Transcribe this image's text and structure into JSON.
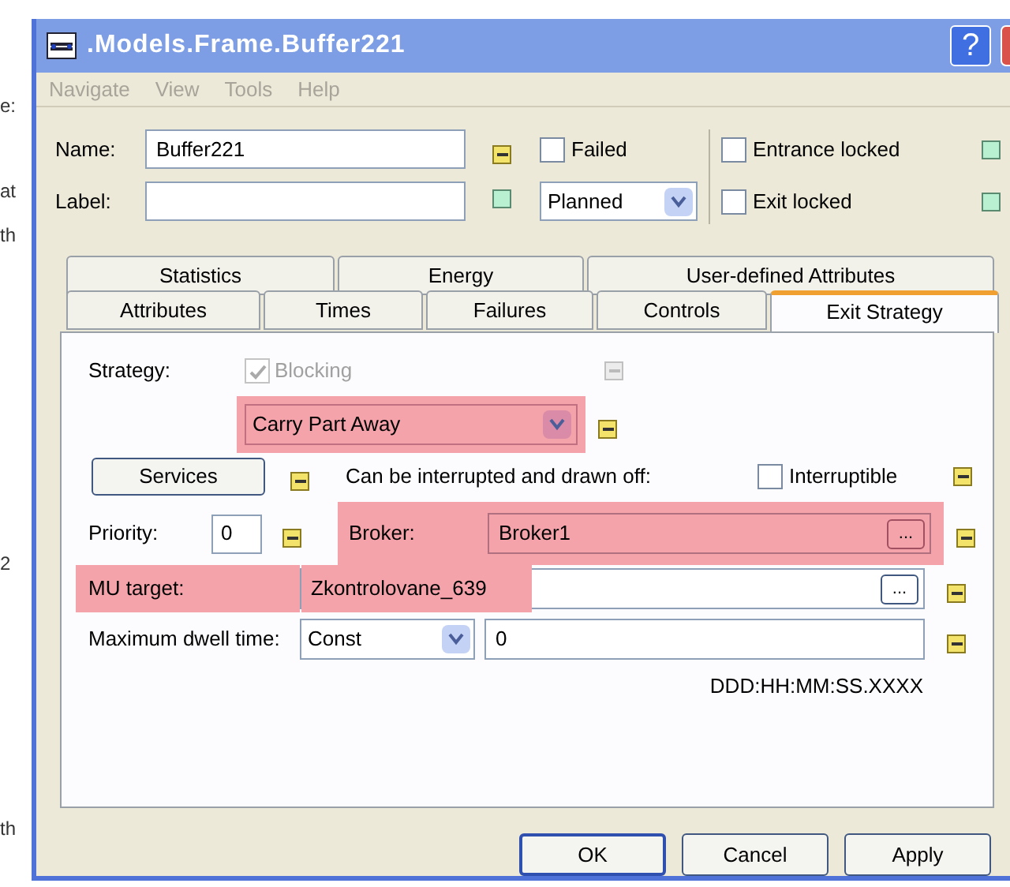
{
  "background_fragments": [
    "e:",
    "at",
    "th",
    "2",
    "th"
  ],
  "window": {
    "title": ".Models.Frame.Buffer221",
    "help": "?"
  },
  "menu": [
    {
      "label": "Navigate",
      "disabled": true
    },
    {
      "label": "View",
      "disabled": true
    },
    {
      "label": "Tools",
      "disabled": true
    },
    {
      "label": "Help",
      "disabled": true
    }
  ],
  "header": {
    "name": {
      "label": "Name:",
      "value": "Buffer221",
      "inherited": true
    },
    "label": {
      "label": "Label:",
      "inherited": false
    },
    "failed": {
      "label": "Failed",
      "checked": false
    },
    "status": {
      "value": "Planned"
    },
    "entrance_locked": {
      "label": "Entrance locked",
      "checked": false,
      "inherited": false
    },
    "exit_locked": {
      "label": "Exit locked",
      "checked": false,
      "inherited": false
    }
  },
  "tab_rows": [
    [
      {
        "label": "Statistics",
        "selected": false
      },
      {
        "label": "Energy",
        "selected": false
      },
      {
        "label": "User-defined Attributes",
        "selected": false
      }
    ],
    [
      {
        "label": "Attributes",
        "selected": false
      },
      {
        "label": "Times",
        "selected": false
      },
      {
        "label": "Failures",
        "selected": false
      },
      {
        "label": "Controls",
        "selected": false
      },
      {
        "label": "Exit Strategy",
        "selected": true
      }
    ]
  ],
  "panel": {
    "strategy": {
      "label": "Strategy:",
      "blocking": {
        "label": "Blocking",
        "checked": true,
        "disabled": true,
        "inherited": true
      },
      "select": {
        "value": "Carry Part Away",
        "highlighted": true,
        "inherited": true
      }
    },
    "services": {
      "button": "Services",
      "inherited": true
    },
    "interrupt": {
      "text": "Can be interrupted and drawn off:",
      "checkbox": {
        "label": "Interruptible",
        "checked": false
      },
      "inherited": true
    },
    "priority": {
      "label": "Priority:",
      "value": "0",
      "inherited": true
    },
    "broker": {
      "label": "Broker:",
      "value": "Broker1",
      "browse": "...",
      "highlighted": true,
      "inherited": true
    },
    "mu_target": {
      "label": "MU target:",
      "value": "Zkontrolovane_639",
      "browse": "...",
      "highlighted": true,
      "inherited": true
    },
    "dwell": {
      "label": "Maximum dwell time:",
      "distribution": "Const",
      "value": "0",
      "inherited": true
    },
    "format": "DDD:HH:MM:SS.XXXX"
  },
  "buttons": [
    {
      "label": "OK",
      "default": true
    },
    {
      "label": "Cancel",
      "default": false
    },
    {
      "label": "Apply",
      "default": false
    }
  ]
}
